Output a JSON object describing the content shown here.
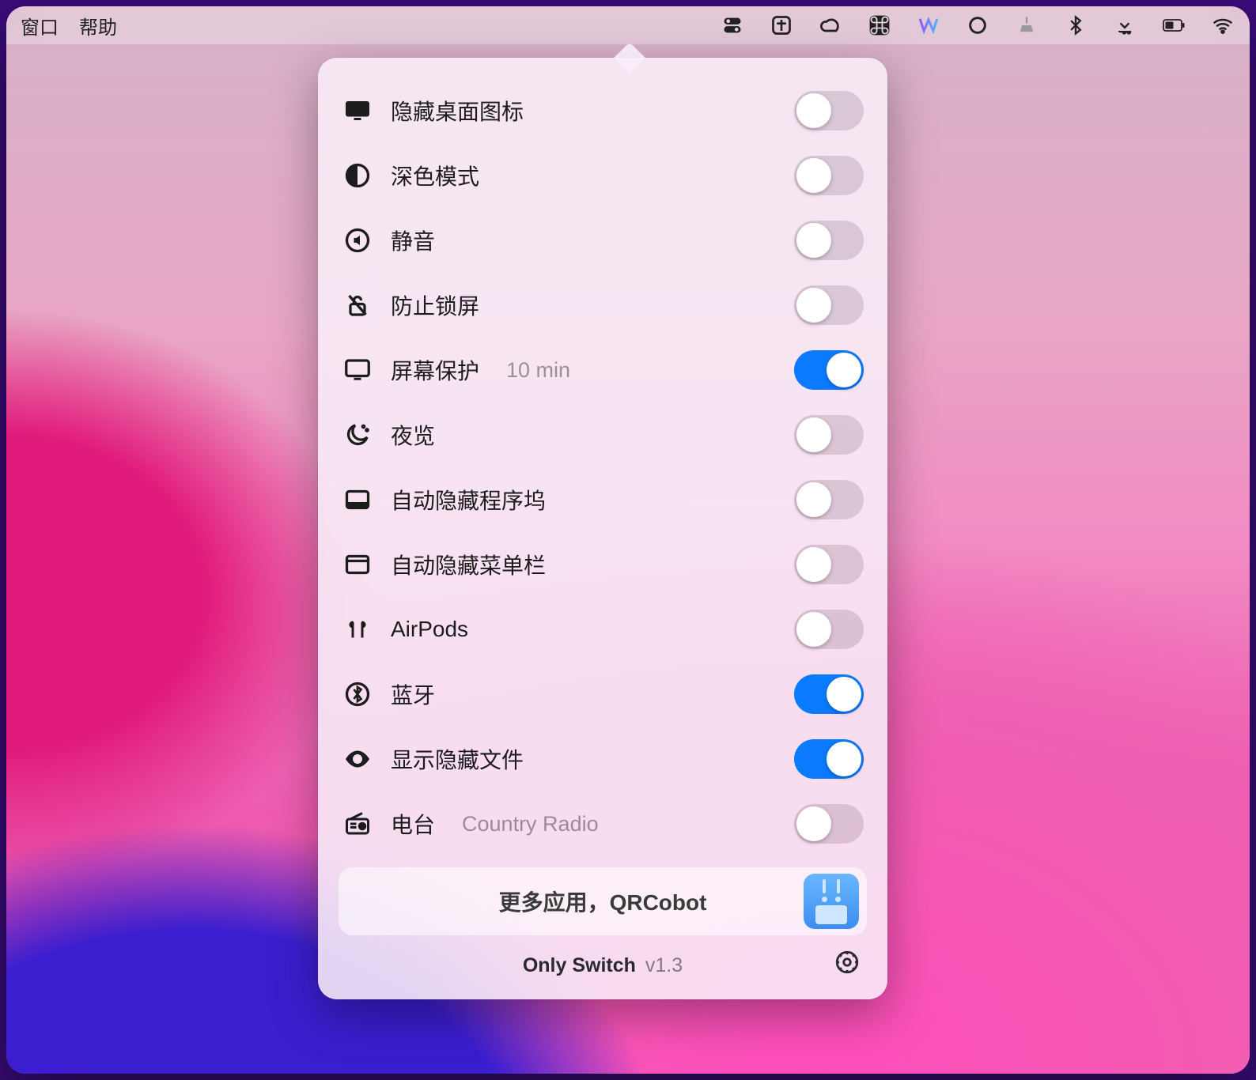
{
  "menubar": {
    "left": [
      "窗口",
      "帮助"
    ]
  },
  "switches": [
    {
      "icon": "display-icon",
      "label": "隐藏桌面图标",
      "sub": "",
      "on": false
    },
    {
      "icon": "dark-mode-icon",
      "label": "深色模式",
      "sub": "",
      "on": false
    },
    {
      "icon": "mute-icon",
      "label": "静音",
      "sub": "",
      "on": false
    },
    {
      "icon": "lock-off-icon",
      "label": "防止锁屏",
      "sub": "",
      "on": false
    },
    {
      "icon": "screensaver-icon",
      "label": "屏幕保护",
      "sub": "10 min",
      "on": true
    },
    {
      "icon": "night-shift-icon",
      "label": "夜览",
      "sub": "",
      "on": false
    },
    {
      "icon": "dock-icon",
      "label": "自动隐藏程序坞",
      "sub": "",
      "on": false
    },
    {
      "icon": "menubar-icon",
      "label": "自动隐藏菜单栏",
      "sub": "",
      "on": false
    },
    {
      "icon": "airpods-icon",
      "label": "AirPods",
      "sub": "",
      "on": false
    },
    {
      "icon": "bluetooth-icon",
      "label": "蓝牙",
      "sub": "",
      "on": true
    },
    {
      "icon": "eye-icon",
      "label": "显示隐藏文件",
      "sub": "",
      "on": true
    },
    {
      "icon": "radio-icon",
      "label": "电台",
      "sub": "Country Radio",
      "on": false
    }
  ],
  "promo": {
    "text": "更多应用，QRCobot"
  },
  "footer": {
    "name": "Only Switch",
    "version": "v1.3"
  },
  "colors": {
    "accent": "#0a7aff"
  }
}
